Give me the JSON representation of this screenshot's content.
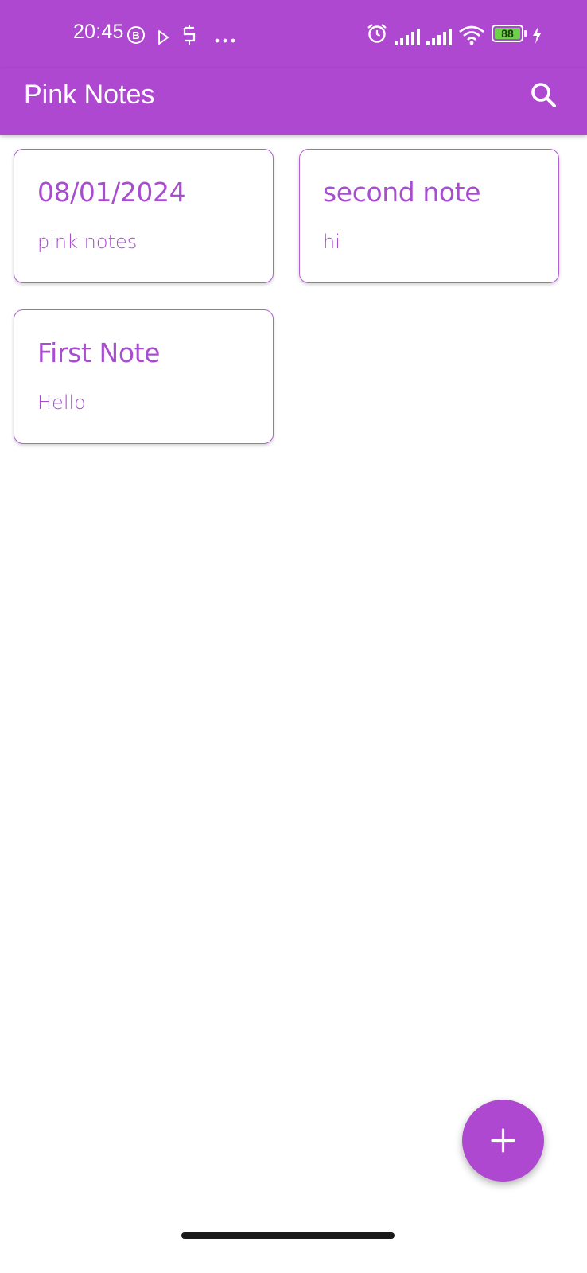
{
  "status_bar": {
    "time": "20:45",
    "battery": "88",
    "icons": [
      "b-circle-icon",
      "play-store-icon",
      "s-app-icon",
      "more-dots-icon",
      "alarm-icon",
      "signal-1-icon",
      "signal-2-icon",
      "wifi-icon",
      "battery-icon",
      "charging-bolt-icon"
    ]
  },
  "app_bar": {
    "title": "Pink Notes",
    "search_icon": "search-icon"
  },
  "notes": [
    {
      "title": "08/01/2024",
      "body": "pink notes"
    },
    {
      "title": "second note",
      "body": "hi"
    },
    {
      "title": "First Note",
      "body": "Hello"
    }
  ],
  "fab": {
    "icon": "plus-icon"
  },
  "colors": {
    "accent": "#ae48d1",
    "note_text": "#a94dd0",
    "battery_fill": "#6ed14a"
  }
}
